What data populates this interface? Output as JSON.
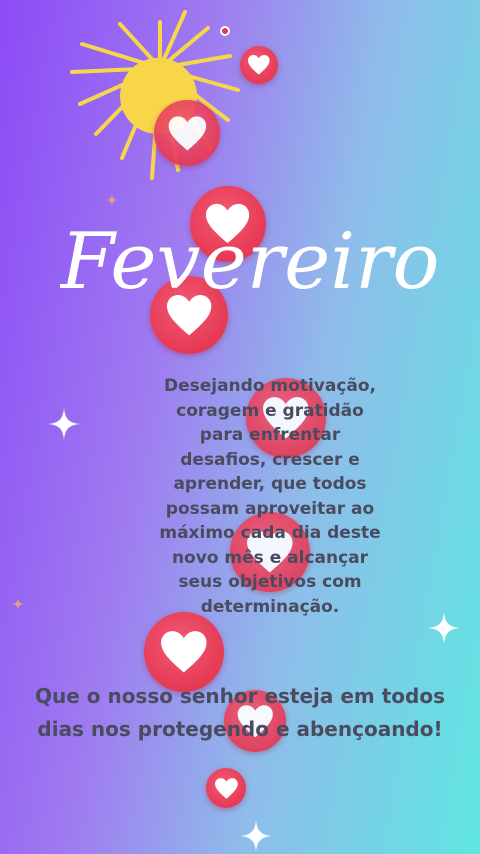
{
  "title": "Fevereiro",
  "message_lines": [
    "Desejando motivação,",
    "coragem e gratidão",
    "para enfrentar",
    "desafios, crescer e",
    "aprender, que todos",
    "possam aproveitar ao",
    "máximo cada dia deste",
    "novo mês e alcançar",
    "seus objetivos com",
    "determinação."
  ],
  "blessing_lines": [
    "Que o nosso senhor esteja em todos",
    "dias nos protegendo e abençoando!"
  ],
  "colors": {
    "gradient_left": "#8c4bf6",
    "gradient_right": "#5fe6e2",
    "heart_red": "#e63954",
    "sun_yellow": "#f7d64a",
    "text_gray": "#4b4b60"
  },
  "decorations": {
    "sun_icon": "sun-icon",
    "heart_icon": "heart-icon",
    "sparkle_icon": "sparkle-icon"
  }
}
